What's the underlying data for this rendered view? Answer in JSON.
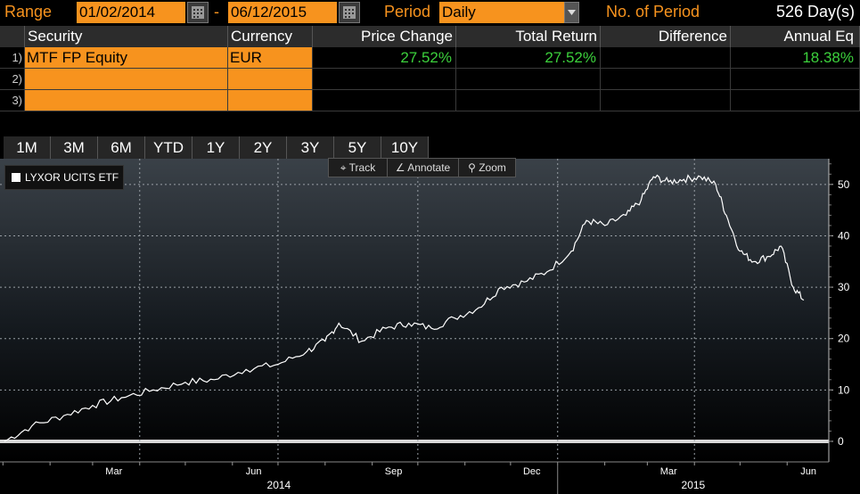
{
  "toolbar": {
    "range_label": "Range",
    "start_date": "01/02/2014",
    "dash": "-",
    "end_date": "06/12/2015",
    "period_label": "Period",
    "period_value": "Daily",
    "num_period_label": "No. of Period",
    "num_period_value": "526 Day(s)"
  },
  "table": {
    "headers": [
      "Security",
      "Currency",
      "Price Change",
      "Total Return",
      "Difference",
      "Annual Eq"
    ],
    "rows": [
      {
        "num": "1)",
        "security": "MTF FP Equity",
        "currency": "EUR",
        "price_change": "27.52%",
        "total_return": "27.52%",
        "difference": "",
        "annual_eq": "18.38%"
      },
      {
        "num": "2)",
        "security": "",
        "currency": "",
        "price_change": "",
        "total_return": "",
        "difference": "",
        "annual_eq": ""
      },
      {
        "num": "3)",
        "security": "",
        "currency": "",
        "price_change": "",
        "total_return": "",
        "difference": "",
        "annual_eq": ""
      }
    ]
  },
  "tabs": [
    "1M",
    "3M",
    "6M",
    "YTD",
    "1Y",
    "2Y",
    "3Y",
    "5Y",
    "10Y"
  ],
  "chart_tools": {
    "track": "Track",
    "annotate": "Annotate",
    "zoom": "Zoom"
  },
  "legend": {
    "name": "LYXOR UCITS ETF",
    "color": "#ffffff"
  },
  "colors": {
    "accent": "#f7931e",
    "positive": "#3cd13c",
    "line": "#ffffff"
  },
  "chart_data": {
    "type": "line",
    "title": "",
    "xlabel": "",
    "ylabel": "",
    "ylim": [
      -4,
      55
    ],
    "yticks": [
      0,
      10,
      20,
      30,
      40,
      50
    ],
    "xticks": [
      "Mar",
      "Jun",
      "Sep",
      "Dec",
      "Mar",
      "Jun"
    ],
    "year_labels": [
      "2014",
      "2015"
    ],
    "grid": true,
    "legend_position": "top-left",
    "series": [
      {
        "name": "LYXOR UCITS ETF",
        "x": [
          "2014-01-02",
          "2014-01-20",
          "2014-02-10",
          "2014-03-01",
          "2014-03-20",
          "2014-04-10",
          "2014-05-01",
          "2014-05-20",
          "2014-06-10",
          "2014-07-01",
          "2014-07-20",
          "2014-08-01",
          "2014-08-10",
          "2014-08-25",
          "2014-09-10",
          "2014-09-25",
          "2014-10-10",
          "2014-10-25",
          "2014-11-10",
          "2014-11-25",
          "2014-12-10",
          "2014-12-25",
          "2015-01-10",
          "2015-01-20",
          "2015-02-01",
          "2015-02-15",
          "2015-02-25",
          "2015-03-05",
          "2015-03-15",
          "2015-03-25",
          "2015-04-05",
          "2015-04-15",
          "2015-04-22",
          "2015-05-01",
          "2015-05-10",
          "2015-05-20",
          "2015-05-28",
          "2015-06-05",
          "2015-06-12"
        ],
        "values": [
          0,
          3,
          5,
          7,
          8.5,
          10,
          11.5,
          12,
          14,
          15,
          17.5,
          19.5,
          23,
          19.5,
          22,
          23,
          22,
          24,
          26,
          30,
          31,
          33,
          37,
          43,
          42,
          44,
          47,
          51.5,
          50.5,
          51,
          51.5,
          50,
          44,
          37,
          35,
          36,
          38,
          30,
          27.5
        ]
      }
    ]
  }
}
